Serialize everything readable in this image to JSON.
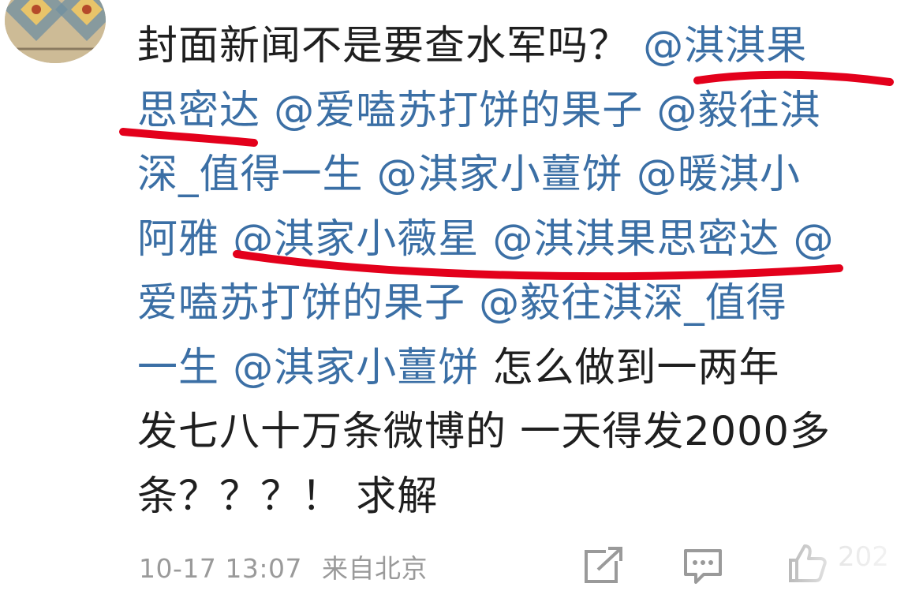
{
  "comment": {
    "lines": [
      [
        {
          "text": "封面新闻不是要查水军吗？ ",
          "type": "plain"
        },
        {
          "text": "@淇淇果",
          "type": "mention"
        }
      ],
      [
        {
          "text": "思密达 ",
          "type": "mention"
        },
        {
          "text": "@爱嗑苏打饼的果子 ",
          "type": "mention"
        },
        {
          "text": "@毅往淇",
          "type": "mention"
        }
      ],
      [
        {
          "text": "深_值得一生 ",
          "type": "mention"
        },
        {
          "text": "@淇家小薑饼 ",
          "type": "mention"
        },
        {
          "text": "@暖淇小",
          "type": "mention"
        }
      ],
      [
        {
          "text": "阿雅 ",
          "type": "mention"
        },
        {
          "text": "@淇家小薇星 ",
          "type": "mention"
        },
        {
          "text": "@淇淇果思密达 ",
          "type": "mention"
        },
        {
          "text": "@",
          "type": "mention"
        }
      ],
      [
        {
          "text": "爱嗑苏打饼的果子 ",
          "type": "mention"
        },
        {
          "text": "@毅往淇深_值得",
          "type": "mention"
        }
      ],
      [
        {
          "text": "一生 ",
          "type": "mention"
        },
        {
          "text": "@淇家小薑饼 ",
          "type": "mention"
        },
        {
          "text": "怎么做到一两年",
          "type": "plain"
        }
      ],
      [
        {
          "text": "发七八十万条微博的 一天得发2000多",
          "type": "plain"
        }
      ],
      [
        {
          "text": "条？？？！ 求解",
          "type": "plain"
        }
      ]
    ]
  },
  "meta": {
    "timestamp": "10-17 13:07",
    "location": "来自北京"
  },
  "actions": {
    "share_icon": "share-icon",
    "comment_icon": "comment-icon",
    "like_icon": "like-icon",
    "like_count": "202"
  },
  "colors": {
    "mention": "#3b6fa5",
    "text": "#1f1f1f",
    "meta": "#9a9a9a",
    "underline": "#e3001b"
  }
}
